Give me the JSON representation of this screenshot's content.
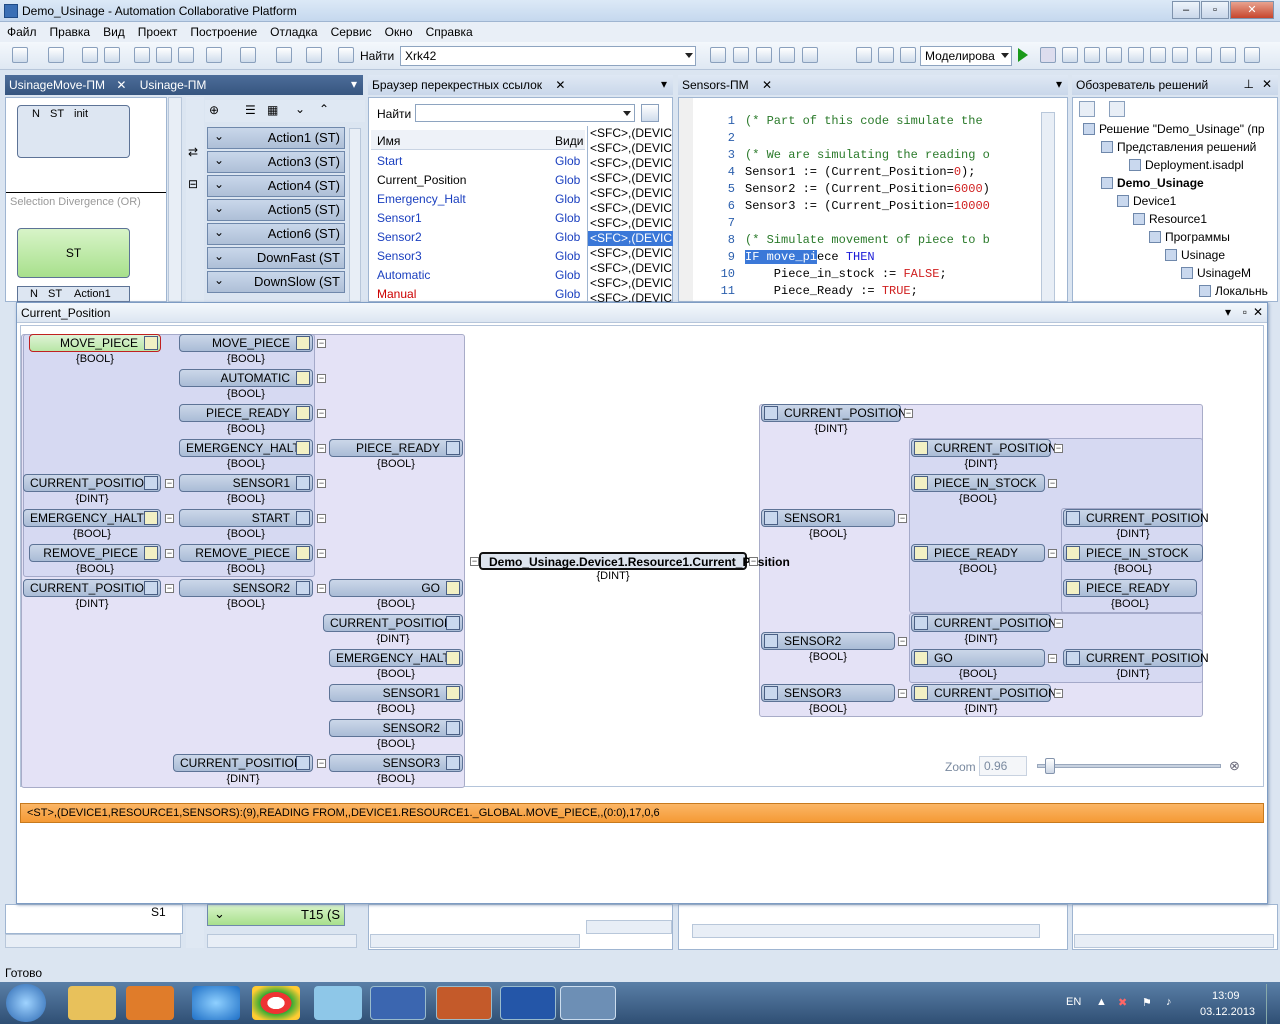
{
  "window": {
    "title": "Demo_Usinage - Automation Collaborative Platform"
  },
  "menu": [
    "Файл",
    "Правка",
    "Вид",
    "Проект",
    "Построение",
    "Отладка",
    "Сервис",
    "Окно",
    "Справка"
  ],
  "toolbar": {
    "find_label": "Найти",
    "find_value": "Xrk42",
    "mode_value": "Моделирова"
  },
  "tabs": {
    "left1": "UsinageMove-ПМ",
    "left2": "Usinage-ПМ",
    "xref": "Браузер перекрестных ссылок",
    "sensors": "Sensors-ПМ",
    "solution": "Обозреватель решений"
  },
  "sfc": {
    "step_init": "init",
    "n": "N",
    "st": "ST",
    "divergence": "Selection Divergence (OR)",
    "step_st": "ST",
    "action1": "Action1",
    "s1": "S1"
  },
  "actions": [
    "Action1 (ST)",
    "Action3 (ST)",
    "Action4 (ST)",
    "Action5 (ST)",
    "Action6 (ST)",
    "DownFast (ST",
    "DownSlow (ST"
  ],
  "action_bottom": "T15 (S",
  "xref": {
    "find_label": "Найти",
    "col_name": "Имя",
    "col_kind": "Види",
    "rows": [
      {
        "name": "Start",
        "kind": "Glob"
      },
      {
        "name": "Current_Position",
        "kind": "Glob"
      },
      {
        "name": "Emergency_Halt",
        "kind": "Glob"
      },
      {
        "name": "Sensor1",
        "kind": "Glob"
      },
      {
        "name": "Sensor2",
        "kind": "Glob"
      },
      {
        "name": "Sensor3",
        "kind": "Glob"
      },
      {
        "name": "Automatic",
        "kind": "Glob"
      },
      {
        "name": "Manual",
        "kind": "Glob"
      }
    ],
    "refs": [
      "<SFC>,(DEVICE",
      "<SFC>,(DEVICE",
      "<SFC>,(DEVICE",
      "<SFC>,(DEVICE",
      "<SFC>,(DEVICE",
      "<SFC>,(DEVICE",
      "<SFC>,(DEVICE",
      "<SFC>,(DEVICE",
      "<SFC>,(DEVICE",
      "<SFC>,(DEVICE",
      "<SFC>,(DEVICE",
      "<SFC>,(DEVICE"
    ]
  },
  "code": {
    "lines": [
      {
        "n": "1",
        "t": "(* Part of this code simulate the"
      },
      {
        "n": "2",
        "t": ""
      },
      {
        "n": "3",
        "t": "(* We are simulating the reading o"
      },
      {
        "n": "4",
        "t": "Sensor1 := (Current_Position=0);"
      },
      {
        "n": "5",
        "t": "Sensor2 := (Current_Position=6000)"
      },
      {
        "n": "6",
        "t": "Sensor3 := (Current_Position=10000"
      },
      {
        "n": "7",
        "t": ""
      },
      {
        "n": "8",
        "t": "(* Simulate movement of piece to b"
      },
      {
        "n": "9",
        "t": "IF move_piece THEN"
      },
      {
        "n": "10",
        "t": "    Piece_in_stock := FALSE;"
      },
      {
        "n": "11",
        "t": "    Piece_Ready := TRUE;"
      }
    ]
  },
  "solution": {
    "items": [
      "Решение \"Demo_Usinage\" (пр",
      "Представления решений",
      "Deployment.isadpl",
      "Demo_Usinage",
      "Device1",
      "Resource1",
      "Программы",
      "Usinage",
      "UsinageM",
      "Локальнь"
    ]
  },
  "graph": {
    "title": "Current_Position",
    "center": "Demo_Usinage.Device1.Resource1.Current_Position",
    "center_type": "{DINT}",
    "left_nodes": [
      "MOVE_PIECE",
      "MOVE_PIECE",
      "AUTOMATIC",
      "PIECE_READY",
      "EMERGENCY_HALT",
      "PIECE_READY",
      "CURRENT_POSITION",
      "SENSOR1",
      "EMERGENCY_HALT",
      "START",
      "REMOVE_PIECE",
      "REMOVE_PIECE",
      "CURRENT_POSITION",
      "SENSOR2",
      "GO",
      "CURRENT_POSITION",
      "EMERGENCY_HALT",
      "SENSOR1",
      "SENSOR2",
      "CURRENT_POSITION",
      "SENSOR3"
    ],
    "right_nodes": [
      "CURRENT_POSITION",
      "CURRENT_POSITION",
      "PIECE_IN_STOCK",
      "SENSOR1",
      "CURRENT_POSITION",
      "PIECE_READY",
      "PIECE_IN_STOCK",
      "PIECE_READY",
      "CURRENT_POSITION",
      "SENSOR2",
      "GO",
      "CURRENT_POSITION",
      "SENSOR3",
      "CURRENT_POSITION"
    ],
    "t_bool": "{BOOL}",
    "t_dint": "{DINT}",
    "zoom_label": "Zoom",
    "zoom_value": "0.96",
    "message": "<ST>,(DEVICE1,RESOURCE1,SENSORS):(9),READING FROM,,DEVICE1.RESOURCE1._GLOBAL.MOVE_PIECE,,(0:0),17,0,6"
  },
  "status": "Готово",
  "tray": {
    "lang": "EN",
    "time": "13:09",
    "date": "03.12.2013"
  }
}
